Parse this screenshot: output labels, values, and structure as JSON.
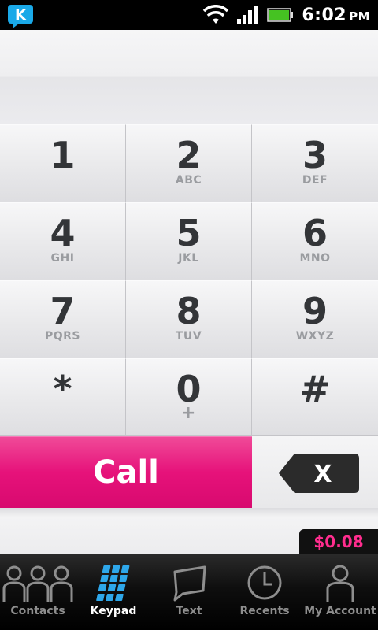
{
  "status_bar": {
    "time": "6:02",
    "ampm": "PM",
    "icons": [
      "app-logo-icon",
      "wifi-icon",
      "signal-icon",
      "battery-icon"
    ]
  },
  "number_display": {
    "value": ""
  },
  "keypad": {
    "keys": [
      {
        "digit": "1",
        "letters": ""
      },
      {
        "digit": "2",
        "letters": "ABC"
      },
      {
        "digit": "3",
        "letters": "DEF"
      },
      {
        "digit": "4",
        "letters": "GHI"
      },
      {
        "digit": "5",
        "letters": "JKL"
      },
      {
        "digit": "6",
        "letters": "MNO"
      },
      {
        "digit": "7",
        "letters": "PQRS"
      },
      {
        "digit": "8",
        "letters": "TUV"
      },
      {
        "digit": "9",
        "letters": "WXYZ"
      },
      {
        "digit": "*",
        "letters": ""
      },
      {
        "digit": "0",
        "letters": "+"
      },
      {
        "digit": "#",
        "letters": ""
      }
    ]
  },
  "call": {
    "label": "Call",
    "color": "#e6127a"
  },
  "backspace": {
    "icon": "backspace-icon",
    "symbol": "X"
  },
  "balance": {
    "amount": "$0.08",
    "color": "#ff2d8e"
  },
  "tabs": [
    {
      "label": "Contacts",
      "icon": "contacts-icon",
      "active": false
    },
    {
      "label": "Keypad",
      "icon": "keypad-icon",
      "active": true
    },
    {
      "label": "Text",
      "icon": "text-icon",
      "active": false
    },
    {
      "label": "Recents",
      "icon": "clock-icon",
      "active": false
    },
    {
      "label": "My Account",
      "icon": "person-icon",
      "active": false
    }
  ]
}
